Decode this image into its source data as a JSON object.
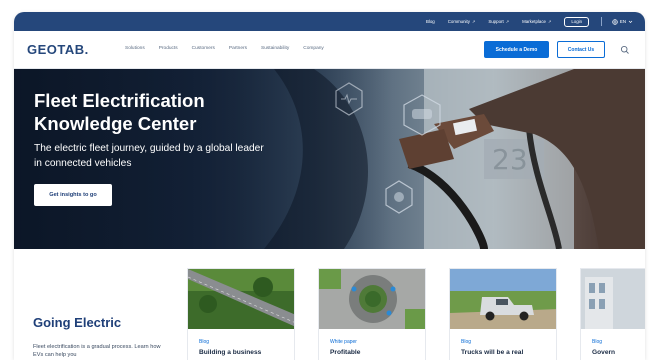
{
  "utility_bar": {
    "items": [
      "Blog",
      "Community",
      "Support",
      "Marketplace"
    ],
    "external_marker": "↗",
    "login_label": "Login",
    "language": "EN"
  },
  "nav": {
    "logo": "GEOTAB",
    "logo_dot": ".",
    "links": [
      "Solutions",
      "Products",
      "Customers",
      "Partners",
      "Sustainability",
      "Company"
    ],
    "demo_button": "Schedule a Demo",
    "contact_button": "Contact Us"
  },
  "hero": {
    "title": "Fleet Electrification Knowledge Center",
    "subtitle": "The electric fleet journey, guided by a global leader in connected vehicles",
    "cta": "Get insights to go"
  },
  "section": {
    "title": "Going Electric",
    "text": "Fleet electrification is a gradual process. Learn how EVs can help you"
  },
  "cards": [
    {
      "tag": "Blog",
      "title": "Building a business"
    },
    {
      "tag": "White paper",
      "title": "Profitable"
    },
    {
      "tag": "Blog",
      "title": "Trucks will be a real"
    },
    {
      "tag": "Blog",
      "title": "Govern"
    }
  ],
  "colors": {
    "brand_navy": "#25477b",
    "accent_blue": "#0a6cd6",
    "heading_blue": "#1f3f78"
  }
}
